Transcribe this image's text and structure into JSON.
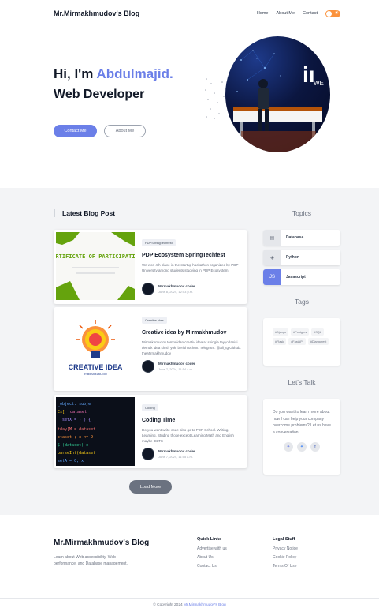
{
  "nav": {
    "brand": "Mr.Mirmakhmudov's Blog",
    "links": [
      "Home",
      "About Me",
      "Contact"
    ],
    "theme_toggle_icon": "sun-icon"
  },
  "hero": {
    "greeting_prefix": "Hi, I'm ",
    "name": "Abdulmajid.",
    "role": "Web Developer",
    "contact_button": "Contact Me",
    "about_button": "About Me",
    "accent_color": "#6b7fe8"
  },
  "latest": {
    "title": "Latest Blog Post",
    "posts": [
      {
        "badge": "PDPSpringTechfest",
        "title": "PDP Ecosystem SpringTechfest",
        "description": "We won 4th place in the startup hackathon organized by PDP University among students studying in PDP Ecosystem.",
        "author": "Mirmakhmudov coder",
        "date": "June 8, 2024, 12:53 p.m.",
        "image_text": "CERTIFICATE OF PARTICIPATION"
      },
      {
        "badge": "Creative idea",
        "title": "Creative idea by Mirmakhmudov",
        "description": "Mirmakhmudov tomonidan creativ idealar shingia tayyorlanisi demak idea shish yoki berish uchun: Telegram: @ali_tg Github: theMirmakhmudov",
        "author": "Mirmakhmudov coder",
        "date": "June 7, 2024, 11:54 a.m.",
        "image_text": "CREATIVE IDEA",
        "image_subtext": "BY MIRMAKHMUDOV"
      },
      {
        "badge": "Coding",
        "title": "Coding Time",
        "description": "Do you want write code also go to PDP School. Writing, Learning, Studing those except Learning Math and English maybe IELTS",
        "author": "Mirmakhmudov coder",
        "date": "June 7, 2024, 11:55 a.m."
      }
    ],
    "load_more": "Load More"
  },
  "sidebar": {
    "topics_title": "Topics",
    "topics": [
      {
        "label": "Database",
        "icon": "database-icon",
        "active": false
      },
      {
        "label": "Python",
        "icon": "python-icon",
        "active": false
      },
      {
        "label": "Javascript",
        "icon": "javascript-icon",
        "active": true
      }
    ],
    "tags_title": "Tags",
    "tags": [
      "#Django",
      "#Postgres",
      "#SQL",
      "#Flask",
      "#FastAPI",
      "#Djangorest"
    ],
    "talk_title": "Let's Talk",
    "talk_text": "Do you want to learn more about how I can help your company overcome problems? Let us have a conversation.",
    "socials": [
      "telegram-icon",
      "twitter-icon",
      "facebook-icon"
    ]
  },
  "footer": {
    "brand": "Mr.Mirmakhmudov's Blog",
    "description": "Learn about Web accessibility, Web performance, and Database management.",
    "quick_links_title": "Quick Links",
    "quick_links": [
      "Advertise with us",
      "About Us",
      "Contact Us"
    ],
    "legal_title": "Legal Stuff",
    "legal_links": [
      "Privacy Notice",
      "Cookie Policy",
      "Terms Of Use"
    ],
    "copyright_prefix": "© Copyright 2024 ",
    "copyright_name": "Mr.Mirmakhmudov's Blog"
  }
}
